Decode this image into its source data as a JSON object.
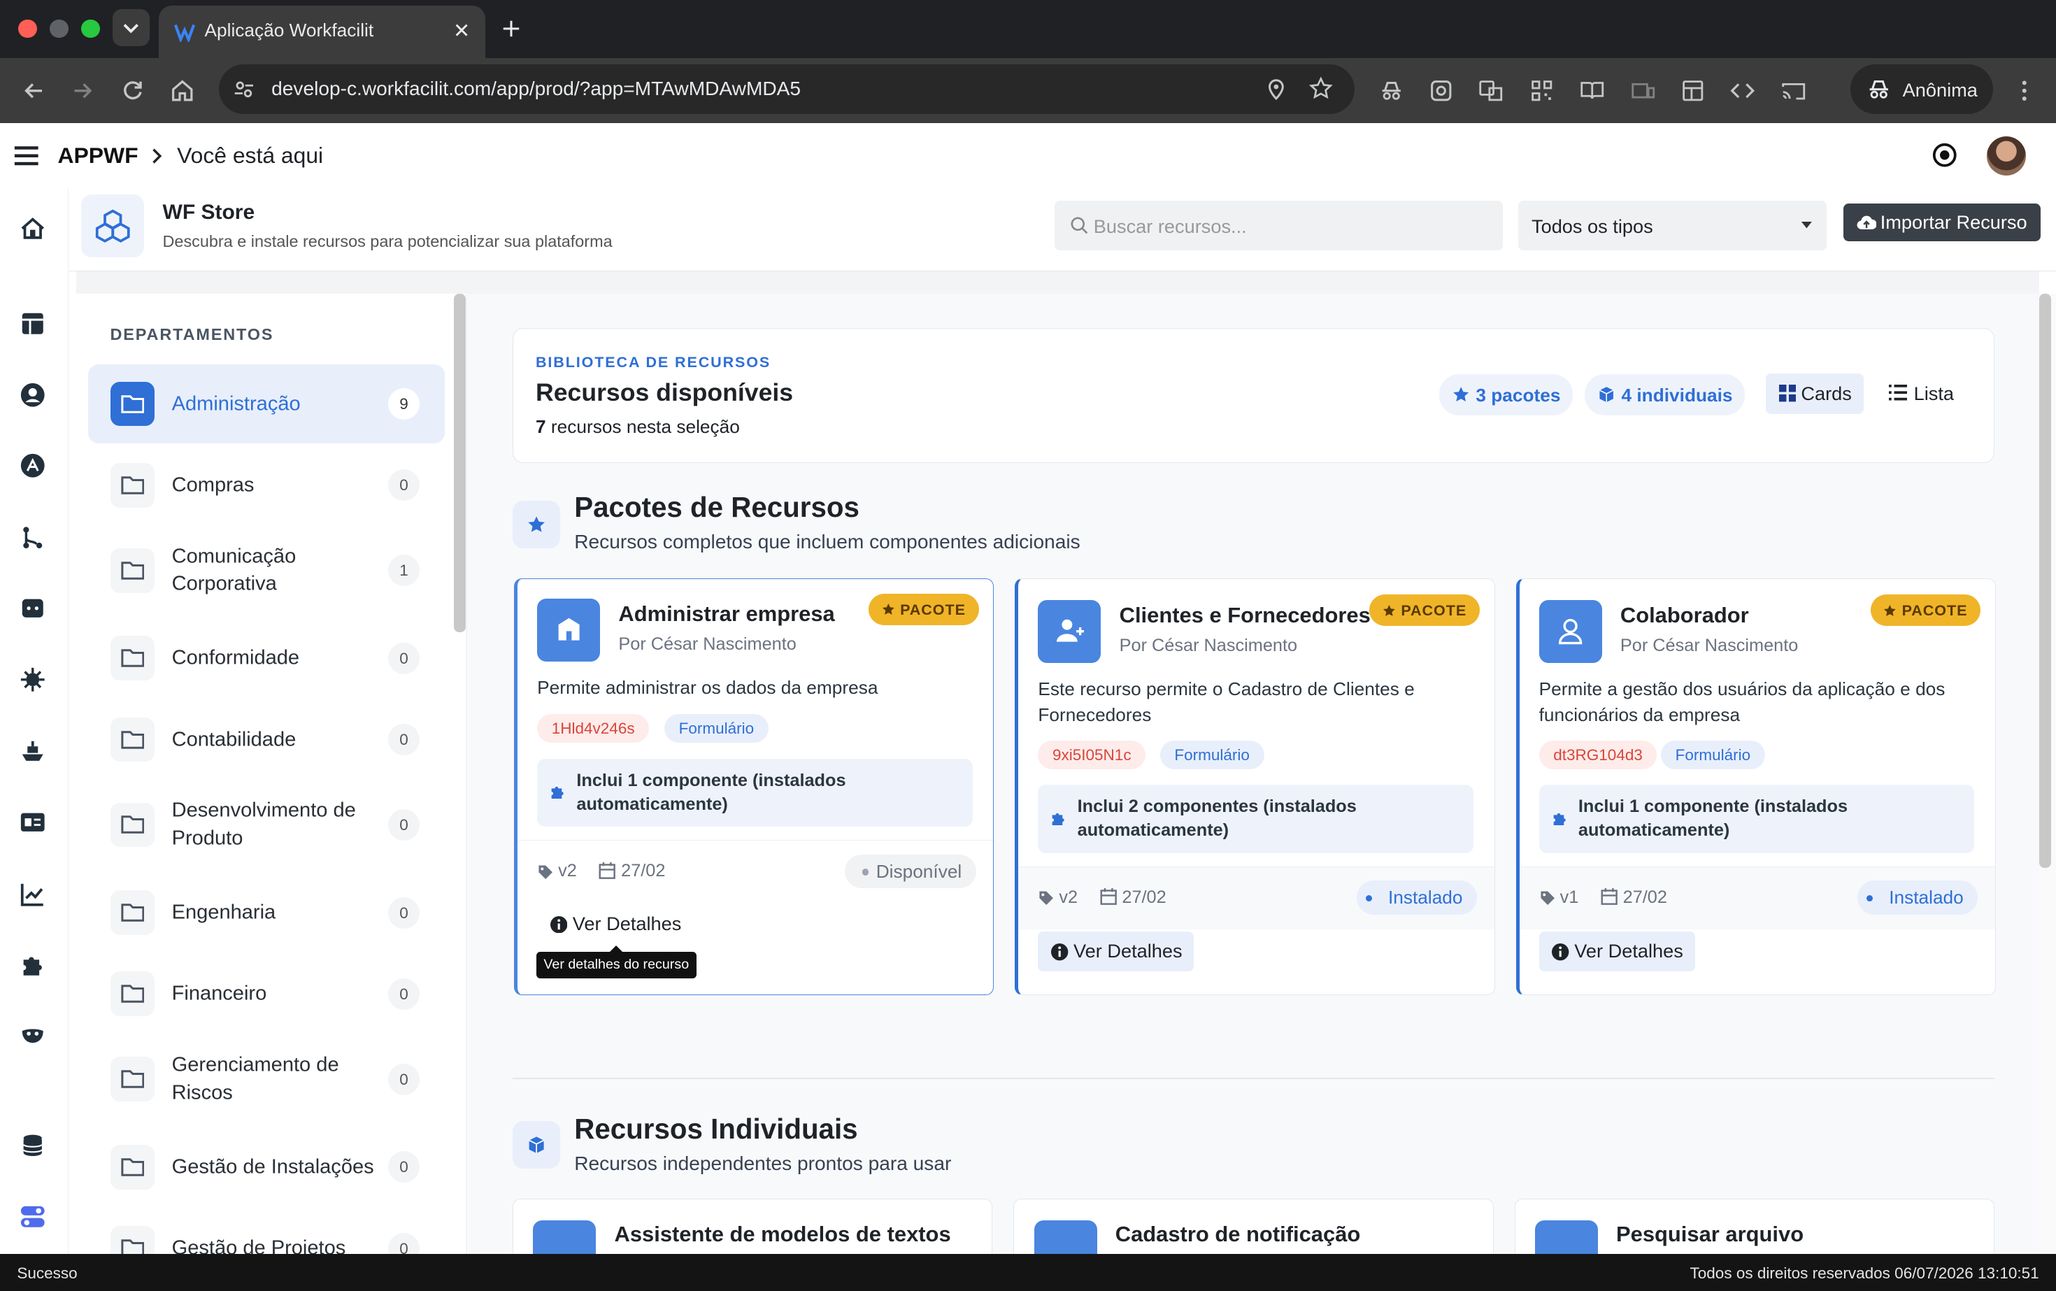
{
  "browser": {
    "tab_title": "Aplicação Workfacilit",
    "url": "develop-c.workfacilit.com/app/prod/?app=MTAwMDAwMDA5",
    "profile_label": "Anônima"
  },
  "header": {
    "app_name": "APPWF",
    "breadcrumb": "Você está aqui"
  },
  "store": {
    "title": "WF Store",
    "subtitle": "Descubra e instale recursos para potencializar sua plataforma",
    "search_placeholder": "Buscar recursos...",
    "type_filter": "Todos os tipos",
    "import_label": "Importar Recurso"
  },
  "sidebar": {
    "heading": "DEPARTAMENTOS",
    "items": [
      {
        "label": "Administração",
        "count": "9"
      },
      {
        "label": "Compras",
        "count": "0"
      },
      {
        "label": "Comunicação Corporativa",
        "count": "1"
      },
      {
        "label": "Conformidade",
        "count": "0"
      },
      {
        "label": "Contabilidade",
        "count": "0"
      },
      {
        "label": "Desenvolvimento de Produto",
        "count": "0"
      },
      {
        "label": "Engenharia",
        "count": "0"
      },
      {
        "label": "Financeiro",
        "count": "0"
      },
      {
        "label": "Gerenciamento de Riscos",
        "count": "0"
      },
      {
        "label": "Gestão de Instalações",
        "count": "0"
      },
      {
        "label": "Gestão de Projetos",
        "count": "0"
      }
    ]
  },
  "library": {
    "eyebrow": "BIBLIOTECA DE RECURSOS",
    "title": "Recursos disponíveis",
    "count": "7",
    "count_suffix": " recursos nesta seleção",
    "packages_chip": "3 pacotes",
    "individual_chip": "4 individuais",
    "view_cards": "Cards",
    "view_list": "Lista"
  },
  "packages": {
    "title": "Pacotes de Recursos",
    "subtitle": "Recursos completos que incluem componentes adicionais",
    "badge": "PACOTE",
    "cards": [
      {
        "name": "Administrar empresa",
        "author": "Por César Nascimento",
        "desc": "Permite administrar os dados da empresa",
        "code": "1Hld4v246s",
        "kind": "Formulário",
        "includes": "Inclui 1 componente (instalados automaticamente)",
        "version": "v2",
        "date": "27/02",
        "status": "Disponível",
        "details": "Ver Detalhes"
      },
      {
        "name": "Clientes e Fornecedores",
        "author": "Por César Nascimento",
        "desc": "Este recurso permite o Cadastro de Clientes e Fornecedores",
        "code": "9xi5I05N1c",
        "kind": "Formulário",
        "includes": "Inclui 2 componentes (instalados automaticamente)",
        "version": "v2",
        "date": "27/02",
        "status": "Instalado",
        "details": "Ver Detalhes"
      },
      {
        "name": "Colaborador",
        "author": "Por César Nascimento",
        "desc": "Permite a gestão dos usuários da aplicação e dos funcionários da empresa",
        "code": "dt3RG104d3",
        "kind": "Formulário",
        "includes": "Inclui 1 componente (instalados automaticamente)",
        "version": "v1",
        "date": "27/02",
        "status": "Instalado",
        "details": "Ver Detalhes"
      }
    ],
    "tooltip": "Ver detalhes do recurso"
  },
  "individuals": {
    "title": "Recursos Individuais",
    "subtitle": "Recursos independentes prontos para usar",
    "cards": [
      "Assistente de modelos de textos",
      "Cadastro de notificação",
      "Pesquisar arquivo"
    ]
  },
  "statusbar": {
    "left": "Sucesso",
    "right": "Todos os direitos reservados 06/07/2026 13:10:51"
  },
  "colors": {
    "accent": "#2f6fd6",
    "badge": "#f0b429",
    "selected_bg": "#e8effb",
    "code_text": "#d9453b"
  }
}
